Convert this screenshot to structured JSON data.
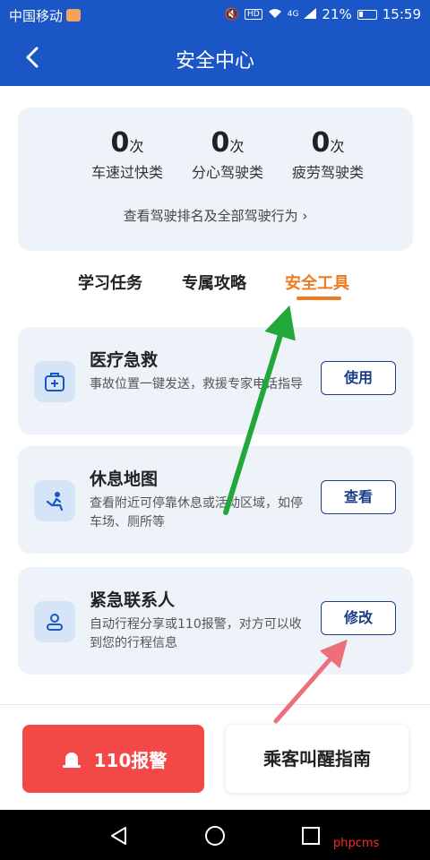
{
  "status_bar": {
    "carrier": "中国移动",
    "battery": "21%",
    "time": "15:59",
    "hd_label": "HD",
    "network_label": "4G"
  },
  "header": {
    "title": "安全中心",
    "back_icon": "chevron-left-icon"
  },
  "stats": {
    "items": [
      {
        "count": "0",
        "unit": "次",
        "label": "车速过快类"
      },
      {
        "count": "0",
        "unit": "次",
        "label": "分心驾驶类"
      },
      {
        "count": "0",
        "unit": "次",
        "label": "疲劳驾驶类"
      }
    ],
    "link_text": "查看驾驶排名及全部驾驶行为 ›"
  },
  "tabs": [
    {
      "label": "学习任务",
      "active": false
    },
    {
      "label": "专属攻略",
      "active": false
    },
    {
      "label": "安全工具",
      "active": true
    }
  ],
  "tools": [
    {
      "title": "医疗急救",
      "desc": "事故位置一键发送，救援专家电话指导",
      "button": "使用",
      "icon": "first-aid-kit-icon"
    },
    {
      "title": "休息地图",
      "desc": "查看附近可停靠休息或活动区域，如停车场、厕所等",
      "button": "查看",
      "icon": "rest-seat-icon"
    },
    {
      "title": "紧急联系人",
      "desc": "自动行程分享或110报警，对方可以收到您的行程信息",
      "button": "修改",
      "icon": "contact-person-icon"
    }
  ],
  "bottom": {
    "alarm_label": "110报警",
    "guide_label": "乘客叫醒指南",
    "alarm_icon": "siren-icon"
  },
  "watermark": "phpcms",
  "colors": {
    "header_blue": "#1b56c6",
    "accent_orange": "#f07a1e",
    "alarm_red": "#f24848",
    "card_bg": "#eef3fa",
    "button_navy": "#1b3f8a",
    "annotation_green": "#22a83a",
    "annotation_red": "#ee6f7c"
  }
}
